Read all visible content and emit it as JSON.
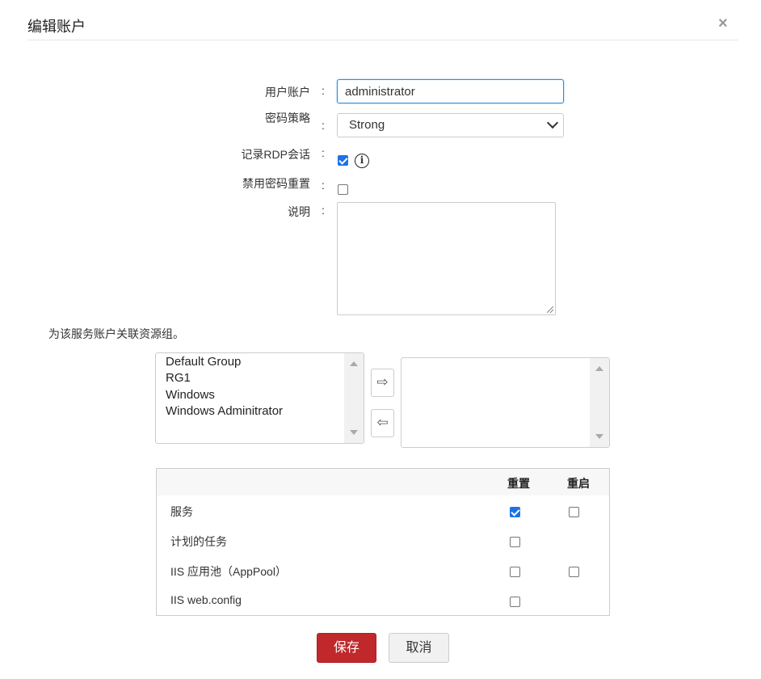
{
  "dialog": {
    "title": "编辑账户",
    "close_label": "×"
  },
  "form": {
    "user_account": {
      "label": "用户账户",
      "colon": ":",
      "value": "administrator"
    },
    "password_policy": {
      "label": "密码策略",
      "colon": ":",
      "value": "Strong"
    },
    "record_rdp": {
      "label": "记录RDP会话",
      "colon": ":",
      "checked": true,
      "info": "i"
    },
    "disable_reset": {
      "label": "禁用密码重置",
      "colon": ":",
      "checked": false
    },
    "description": {
      "label": "说明",
      "colon": ":",
      "value": ""
    }
  },
  "resource_groups": {
    "label": "为该服务账户关联资源组。",
    "available": [
      "Default Group",
      "RG1",
      "Windows",
      "Windows Adminitrator"
    ],
    "selected": [],
    "move_right": "⇨",
    "move_left": "⇦"
  },
  "table": {
    "headers": [
      "",
      "重置",
      "重启"
    ],
    "rows": [
      {
        "name": "服务",
        "reset": true,
        "restart": false
      },
      {
        "name": "计划的任务",
        "reset": false
      },
      {
        "name": "IIS 应用池（AppPool）",
        "reset": false,
        "restart": false
      },
      {
        "name": "IIS web.config",
        "reset": false
      }
    ]
  },
  "buttons": {
    "save": "保存",
    "cancel": "取消"
  },
  "colors": {
    "accent": "#c0282b",
    "focus": "#2a8fd6",
    "checkbox": "#1a73e8"
  }
}
